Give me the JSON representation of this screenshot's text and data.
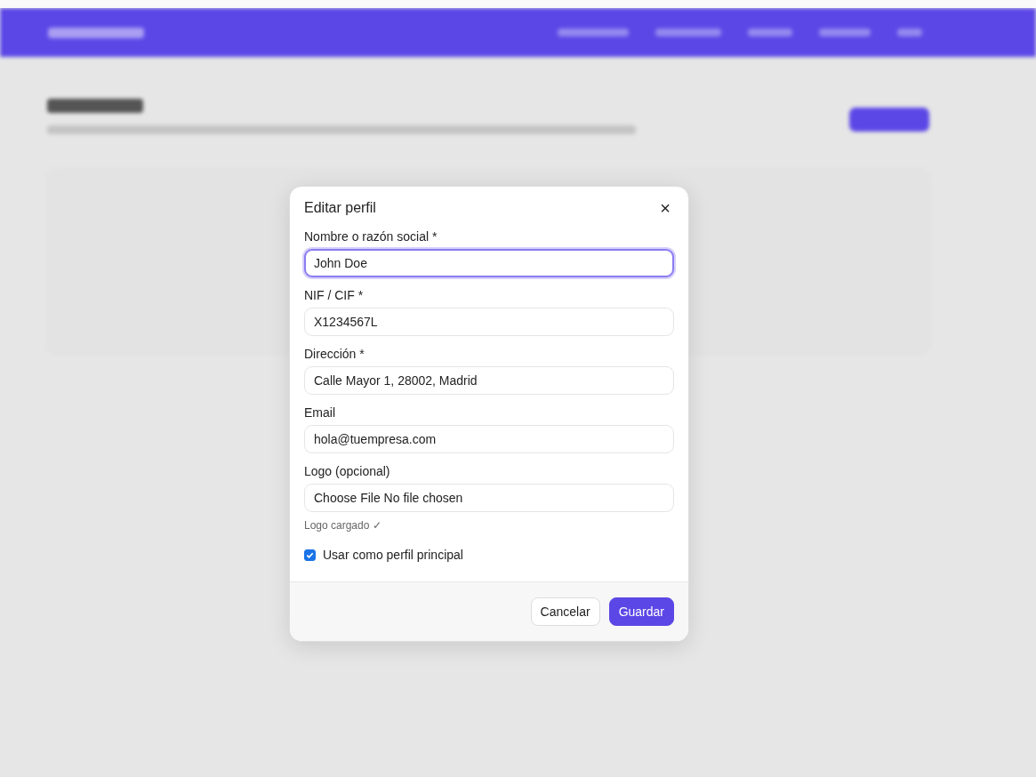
{
  "dialog": {
    "title": "Editar perfil",
    "close": "×",
    "fields": [
      {
        "label": "Nombre o razón social *",
        "value": "John Doe",
        "focused": true
      },
      {
        "label": "NIF / CIF *",
        "value": "X1234567L",
        "focused": false
      },
      {
        "label": "Dirección *",
        "value": "Calle Mayor 1, 28002, Madrid",
        "focused": false
      },
      {
        "label": "Email",
        "value": "hola@tuempresa.com",
        "focused": false
      },
      {
        "label": "Logo (opcional)",
        "value": "Choose File No file chosen",
        "focused": false
      }
    ],
    "note": "Logo cargado ✓",
    "checkbox": {
      "label": "Usar como perfil principal",
      "checked": true
    },
    "buttons": [
      {
        "label": "Cancelar",
        "kind": "secondary"
      },
      {
        "label": "Guardar",
        "kind": "primary"
      }
    ]
  }
}
